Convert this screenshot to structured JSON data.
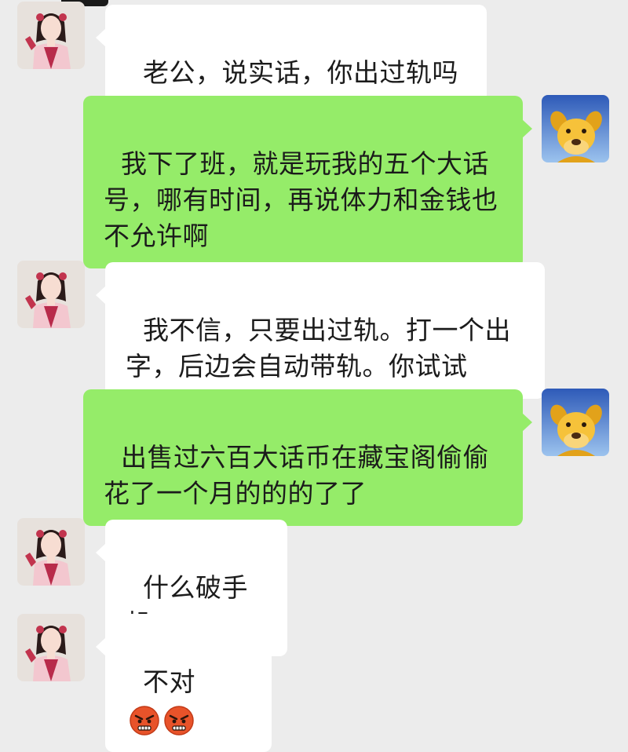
{
  "conversation": {
    "messages": [
      {
        "id": 1,
        "side": "left",
        "text": "老公，说实话，你出过轨吗"
      },
      {
        "id": 2,
        "side": "right",
        "text": "我下了班，就是玩我的五个大话号，哪有时间，再说体力和金钱也不允许啊"
      },
      {
        "id": 3,
        "side": "left",
        "text": "我不信，只要出过轨。打一个出字，后边会自动带轨。你试试"
      },
      {
        "id": 4,
        "side": "right",
        "text": "出售过六百大话币在藏宝阁偷偷花了一个月的的的了了"
      },
      {
        "id": 5,
        "side": "left",
        "text": "什么破手机"
      },
      {
        "id": 6,
        "side": "left",
        "text": "不对",
        "emojis": [
          "angry-face-emoji",
          "angry-face-emoji"
        ]
      }
    ]
  },
  "avatars": {
    "left": "girl-character-avatar",
    "right": "yellow-dog-avatar"
  },
  "colors": {
    "background": "#ececec",
    "incoming_bubble": "#ffffff",
    "outgoing_bubble": "#95ec69",
    "text": "#1b1b1b"
  }
}
